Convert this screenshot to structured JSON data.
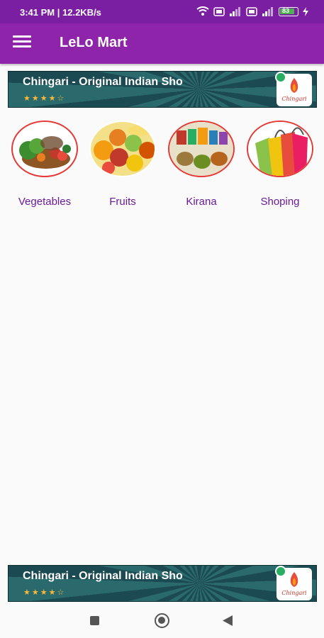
{
  "status_bar": {
    "time": "3:41 PM | 12.2KB/s",
    "battery": "83"
  },
  "app_bar": {
    "title": "LeLo Mart"
  },
  "ads": [
    {
      "title": "Chingari - Original Indian Sho",
      "stars": "★★★★☆",
      "logo_text": "Chingari"
    },
    {
      "title": "Chingari - Original Indian Sho",
      "stars": "★★★★☆",
      "logo_text": "Chingari"
    }
  ],
  "categories": [
    {
      "label": "Vegetables",
      "icon": "vegetables-image"
    },
    {
      "label": "Fruits",
      "icon": "fruits-image"
    },
    {
      "label": "Kirana",
      "icon": "kirana-image"
    },
    {
      "label": "Shoping",
      "icon": "shopping-bags-image"
    }
  ],
  "colors": {
    "primary": "#8e24aa",
    "status": "#7b1fa2",
    "accent_border": "#e53935",
    "label": "#6a1b9a"
  }
}
